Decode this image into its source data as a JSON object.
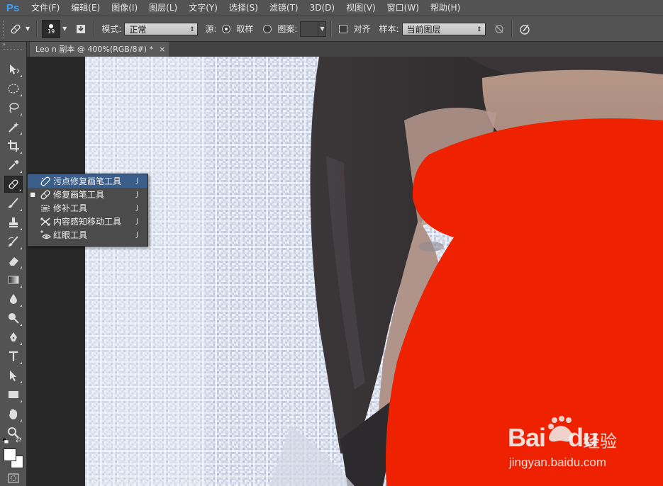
{
  "app": {
    "logo": "Ps"
  },
  "menu": [
    "文件(F)",
    "编辑(E)",
    "图像(I)",
    "图层(L)",
    "文字(Y)",
    "选择(S)",
    "滤镜(T)",
    "3D(D)",
    "视图(V)",
    "窗口(W)",
    "帮助(H)"
  ],
  "options": {
    "brush_size": "19",
    "mode_label": "模式:",
    "mode_value": "正常",
    "source_label": "源:",
    "sampled_label": "取样",
    "pattern_label": "图案:",
    "aligned_label": "对齐",
    "sample_label": "样本:",
    "sample_value": "当前图层"
  },
  "document": {
    "tab_title": "Leo n 副本 @ 400%(RGB/8#) *",
    "close_glyph": "×"
  },
  "toolpanel": {
    "header_glyph": "»"
  },
  "flyout": {
    "items": [
      {
        "label": "污点修复画笔工具",
        "shortcut": "J",
        "icon": "spot-healing-brush-icon",
        "selected": false,
        "hovered": true
      },
      {
        "label": "修复画笔工具",
        "shortcut": "J",
        "icon": "healing-brush-icon",
        "selected": true,
        "hovered": false
      },
      {
        "label": "修补工具",
        "shortcut": "J",
        "icon": "patch-icon",
        "selected": false,
        "hovered": false
      },
      {
        "label": "内容感知移动工具",
        "shortcut": "J",
        "icon": "content-aware-move-icon",
        "selected": false,
        "hovered": false
      },
      {
        "label": "红眼工具",
        "shortcut": "J",
        "icon": "red-eye-icon",
        "selected": false,
        "hovered": false
      }
    ]
  },
  "watermark": {
    "brand_left": "Bai",
    "brand_right": "du",
    "cn": "经验",
    "url": "jingyan.baidu.com"
  },
  "colors": {
    "accent": "#3aa0ff",
    "ui": "#535353",
    "redfill": "#ee2200",
    "hover": "#3b5f8a"
  }
}
